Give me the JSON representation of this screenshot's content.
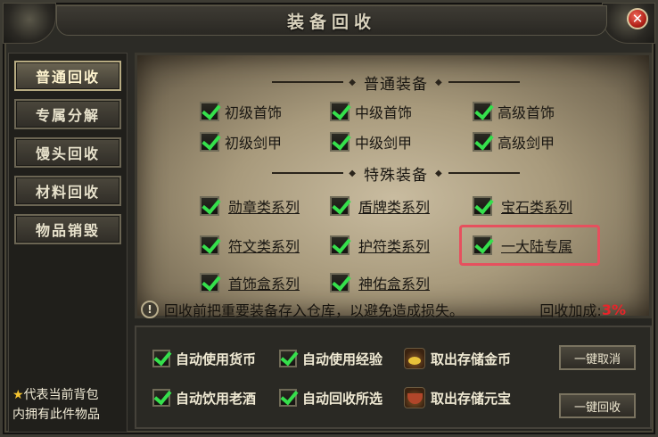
{
  "window": {
    "title": "装备回收",
    "close_label": "✕"
  },
  "sidebar": {
    "tabs": [
      {
        "label": "普通回收",
        "active": true
      },
      {
        "label": "专属分解",
        "active": false
      },
      {
        "label": "馒头回收",
        "active": false
      },
      {
        "label": "材料回收",
        "active": false
      },
      {
        "label": "物品销毁",
        "active": false
      }
    ],
    "legend_icon": "star-icon",
    "legend_text_1": "代表当前背包",
    "legend_text_2": "内拥有此件物品"
  },
  "normal_section": {
    "title": "普通装备",
    "items": [
      "初级首饰",
      "中级首饰",
      "高级首饰",
      "初级剑甲",
      "中级剑甲",
      "高级剑甲"
    ]
  },
  "special_section": {
    "title": "特殊装备",
    "items": [
      "勋章类系列",
      "盾牌类系列",
      "宝石类系列",
      "符文类系列",
      "护符类系列",
      "一大陆专属",
      "首饰盒系列",
      "神佑盒系列"
    ]
  },
  "notice": {
    "icon": "!",
    "text": "回收前把重要装备存入仓库，以避免造成损失。",
    "bonus_label": "回收加成:",
    "bonus_value": "3%"
  },
  "auto_options": {
    "use_currency": "自动使用货币",
    "use_exp": "自动使用经验",
    "drink_wine": "自动饮用老酒",
    "recycle_selected": "自动回收所选",
    "withdraw_gold": "取出存储金币",
    "withdraw_yuanbao": "取出存储元宝"
  },
  "buttons": {
    "cancel_all": "一键取消",
    "recycle_all": "一键回收"
  },
  "colors": {
    "check": "#35e04c",
    "highlight": "#e6505e",
    "bonus": "#e8242a"
  }
}
